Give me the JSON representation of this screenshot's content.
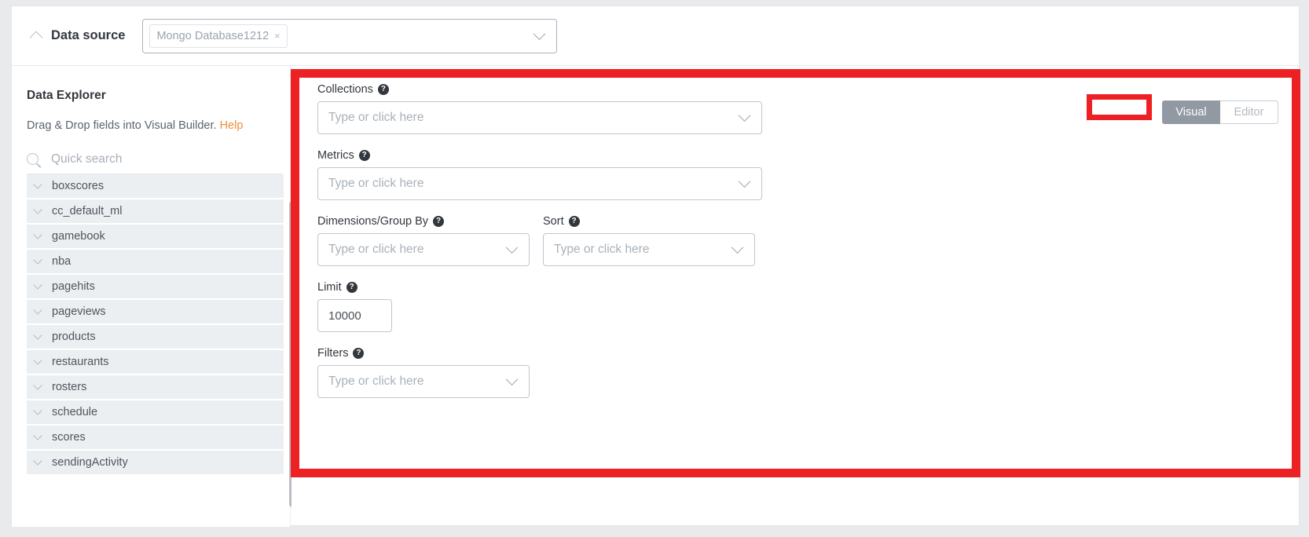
{
  "data_source": {
    "section_label": "Data source",
    "collapse_icon": "chevron-up-icon",
    "selected_chip": "Mongo Database1212",
    "chip_remove_icon": "×",
    "dropdown_caret_icon": "chevron-down-icon"
  },
  "explorer": {
    "title": "Data Explorer",
    "subtitle_text": "Drag & Drop fields into Visual Builder.",
    "help_link": "Help",
    "search_icon": "search-icon",
    "search_placeholder": "Quick search",
    "search_value": "",
    "collections": [
      "boxscores",
      "cc_default_ml",
      "gamebook",
      "nba",
      "pagehits",
      "pageviews",
      "products",
      "restaurants",
      "rosters",
      "schedule",
      "scores",
      "sendingActivity"
    ],
    "item_expand_icon": "chevron-down-icon"
  },
  "builder": {
    "mode_toggle": {
      "visual_label": "Visual",
      "editor_label": "Editor",
      "active": "Visual"
    },
    "help_icon": "question-mark-icon",
    "placeholder": "Type or click here",
    "fields": {
      "collections": {
        "label": "Collections",
        "value": ""
      },
      "metrics": {
        "label": "Metrics",
        "value": ""
      },
      "dimensions": {
        "label": "Dimensions/Group By",
        "value": ""
      },
      "sort": {
        "label": "Sort",
        "value": ""
      },
      "limit": {
        "label": "Limit",
        "value": "10000"
      },
      "filters": {
        "label": "Filters",
        "value": ""
      }
    }
  },
  "annotations": {
    "color": "#ed2024",
    "main_region": "visual-builder-panel",
    "focus_region": "visual-mode-button"
  },
  "colors": {
    "accent_orange": "#ef8d3c",
    "active_toggle_bg": "#919aa3",
    "annotation_red": "#ed2024",
    "row_bg": "#eceff1"
  }
}
